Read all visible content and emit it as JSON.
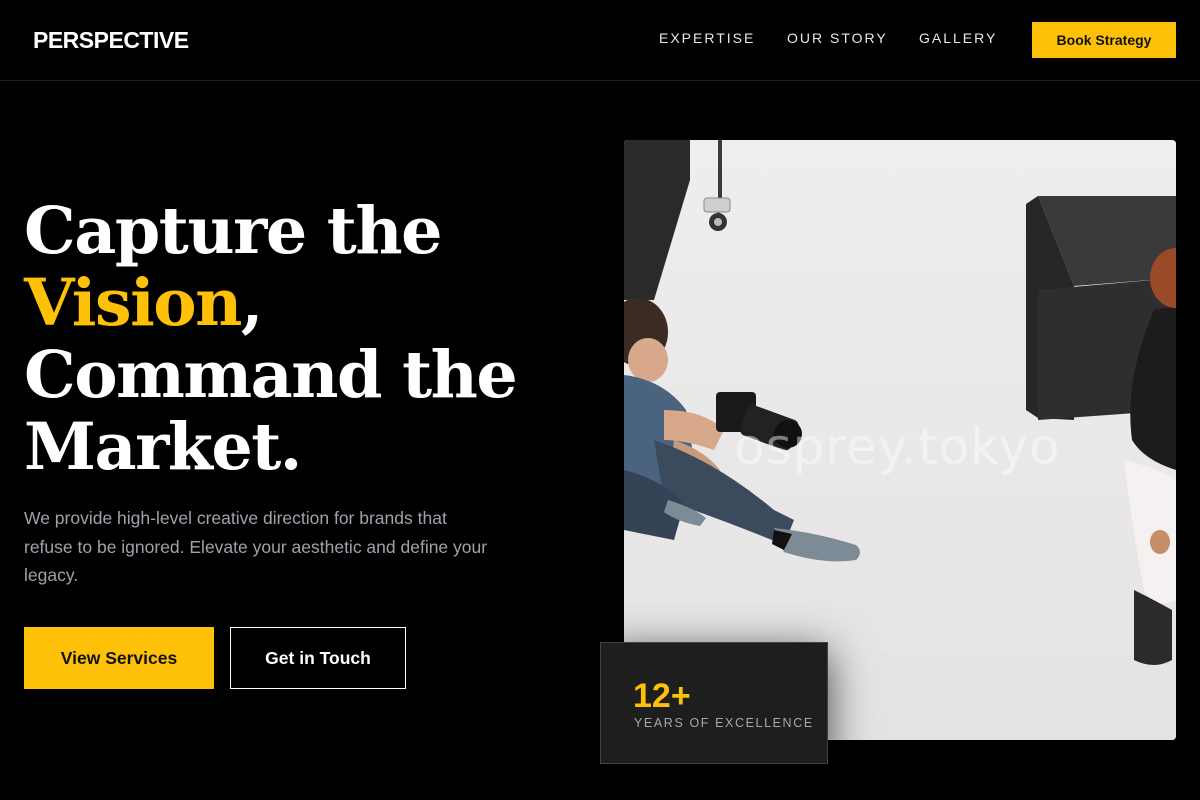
{
  "brand": {
    "logo": "PERSPECTIVE",
    "accent_color": "#FFC107"
  },
  "nav": {
    "links": [
      "EXPERTISE",
      "OUR STORY",
      "GALLERY"
    ],
    "cta": "Book Strategy"
  },
  "hero": {
    "headline": {
      "line1": "Capture the",
      "accent": "Vision",
      "after_accent": ",",
      "line3": "Command the",
      "line4": "Market."
    },
    "subtext": "We provide high-level creative direction for brands that refuse to be ignored. Elevate your aesthetic and define your legacy.",
    "primary_button": "View Services",
    "secondary_button": "Get in Touch",
    "image": {
      "watermark": "osprey.tokyo"
    }
  },
  "stat": {
    "value": "12+",
    "label": "YEARS OF EXCELLENCE"
  }
}
